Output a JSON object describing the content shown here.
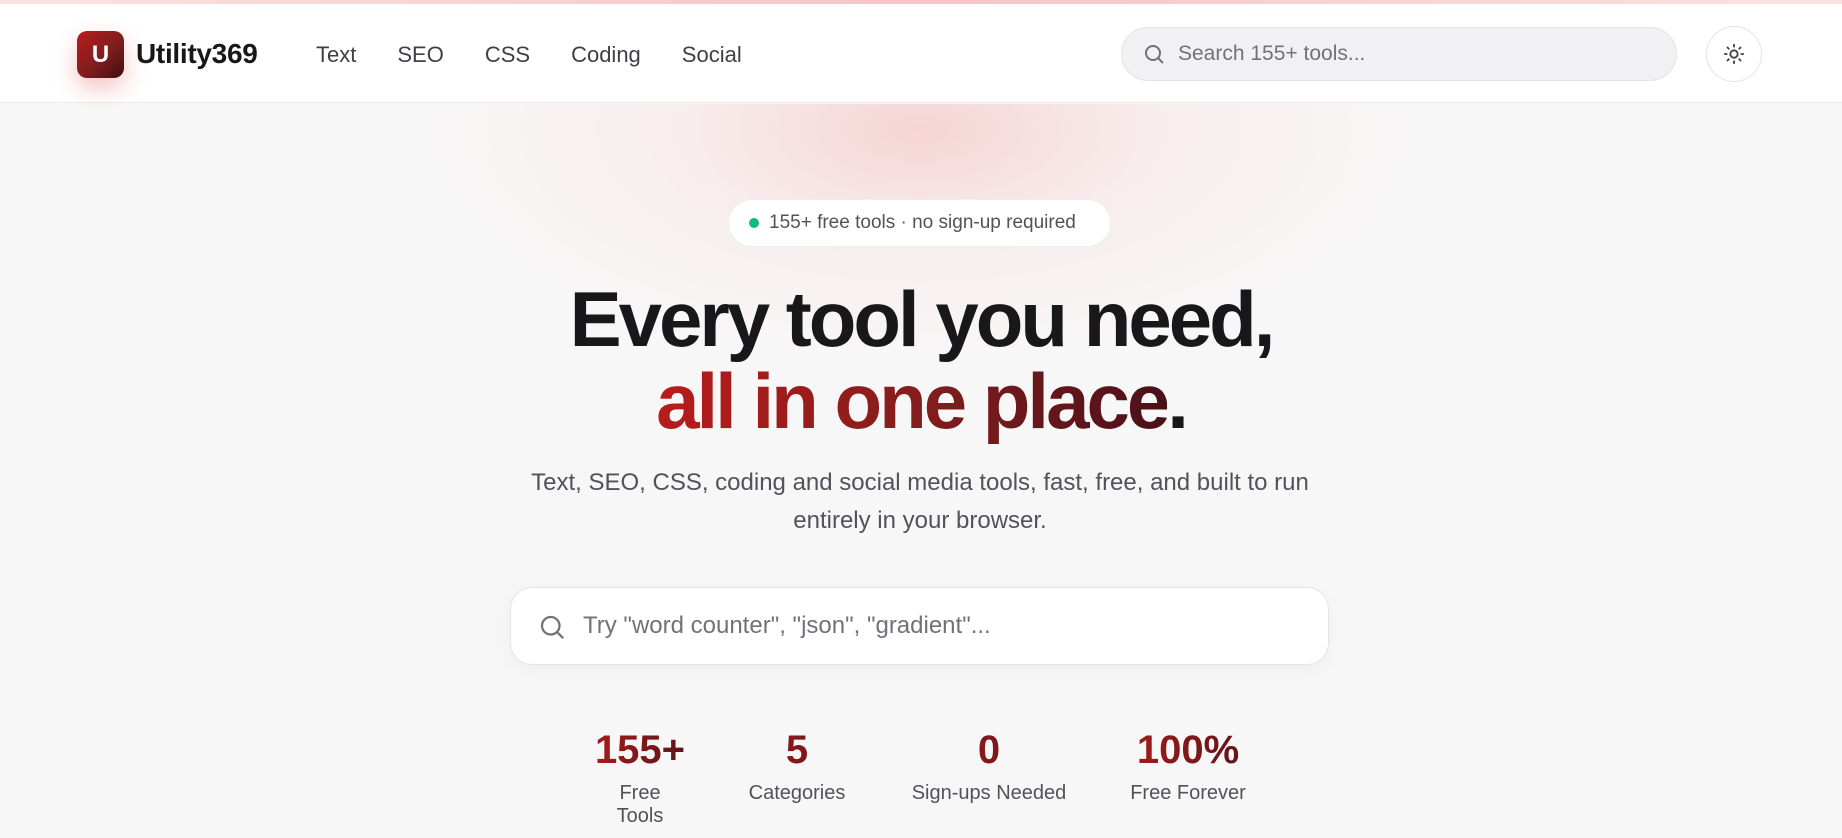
{
  "brand": {
    "logo_letter": "U",
    "name": "Utility369"
  },
  "nav": [
    "Text",
    "SEO",
    "CSS",
    "Coding",
    "Social"
  ],
  "top_search": {
    "placeholder": "Search 155+ tools..."
  },
  "theme_toggle": {
    "icon": "sun-icon"
  },
  "hero": {
    "badge": "155+ free tools · no sign-up required",
    "headline_line1": "Every tool you need,",
    "headline_accent": "all in one place",
    "headline_period": ".",
    "subtitle": "Text, SEO, CSS, coding and social media tools, fast, free, and built to run entirely in your browser.",
    "search_placeholder": "Try \"word counter\", \"json\", \"gradient\"..."
  },
  "stats": [
    {
      "value": "155+",
      "label": "Free Tools"
    },
    {
      "value": "5",
      "label": "Categories"
    },
    {
      "value": "0",
      "label": "Sign-ups Needed"
    },
    {
      "value": "100%",
      "label": "Free Forever"
    }
  ],
  "colors": {
    "accent": "#b91c1c",
    "accent_dark": "#7f1d1d",
    "badge_dot": "#10b981"
  }
}
